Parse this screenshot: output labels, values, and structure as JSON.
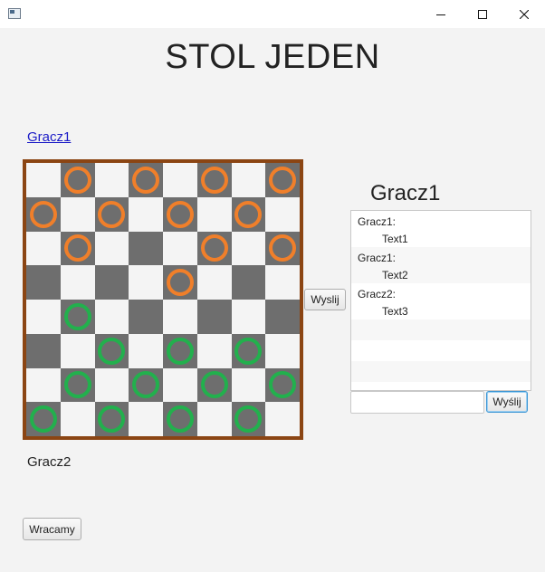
{
  "window": {
    "minimize_icon": "minimize-icon",
    "maximize_icon": "maximize-icon",
    "close_icon": "close-icon"
  },
  "title": "STOL JEDEN",
  "top_player_link": "Gracz1",
  "bottom_player_label": "Gracz2",
  "board": {
    "rows": 8,
    "cols": 8,
    "border_color": "#8b4513",
    "light_color": "#f4f4f4",
    "dark_color": "#6e6e6e",
    "pieces": [
      {
        "row": 0,
        "col": 1,
        "color": "orange"
      },
      {
        "row": 0,
        "col": 3,
        "color": "orange"
      },
      {
        "row": 0,
        "col": 5,
        "color": "orange"
      },
      {
        "row": 0,
        "col": 7,
        "color": "orange"
      },
      {
        "row": 1,
        "col": 0,
        "color": "orange"
      },
      {
        "row": 1,
        "col": 2,
        "color": "orange"
      },
      {
        "row": 1,
        "col": 4,
        "color": "orange"
      },
      {
        "row": 1,
        "col": 6,
        "color": "orange"
      },
      {
        "row": 2,
        "col": 1,
        "color": "orange"
      },
      {
        "row": 2,
        "col": 5,
        "color": "orange"
      },
      {
        "row": 2,
        "col": 7,
        "color": "orange"
      },
      {
        "row": 3,
        "col": 4,
        "color": "orange"
      },
      {
        "row": 4,
        "col": 1,
        "color": "green"
      },
      {
        "row": 5,
        "col": 2,
        "color": "green"
      },
      {
        "row": 5,
        "col": 4,
        "color": "green"
      },
      {
        "row": 5,
        "col": 6,
        "color": "green"
      },
      {
        "row": 6,
        "col": 1,
        "color": "green"
      },
      {
        "row": 6,
        "col": 3,
        "color": "green"
      },
      {
        "row": 6,
        "col": 5,
        "color": "green"
      },
      {
        "row": 6,
        "col": 7,
        "color": "green"
      },
      {
        "row": 7,
        "col": 0,
        "color": "green"
      },
      {
        "row": 7,
        "col": 2,
        "color": "green"
      },
      {
        "row": 7,
        "col": 4,
        "color": "green"
      },
      {
        "row": 7,
        "col": 6,
        "color": "green"
      }
    ],
    "piece_colors": {
      "orange": "#f07f2a",
      "green": "#22b04d"
    }
  },
  "send_move_label": "Wyslij",
  "chat": {
    "header": "Gracz1",
    "messages": [
      {
        "sender": "Gracz1:",
        "text": "Text1"
      },
      {
        "sender": "Gracz1:",
        "text": "Text2"
      },
      {
        "sender": "Gracz2:",
        "text": "Text3"
      }
    ],
    "input_value": "",
    "send_label": "Wyślij"
  },
  "back_label": "Wracamy"
}
